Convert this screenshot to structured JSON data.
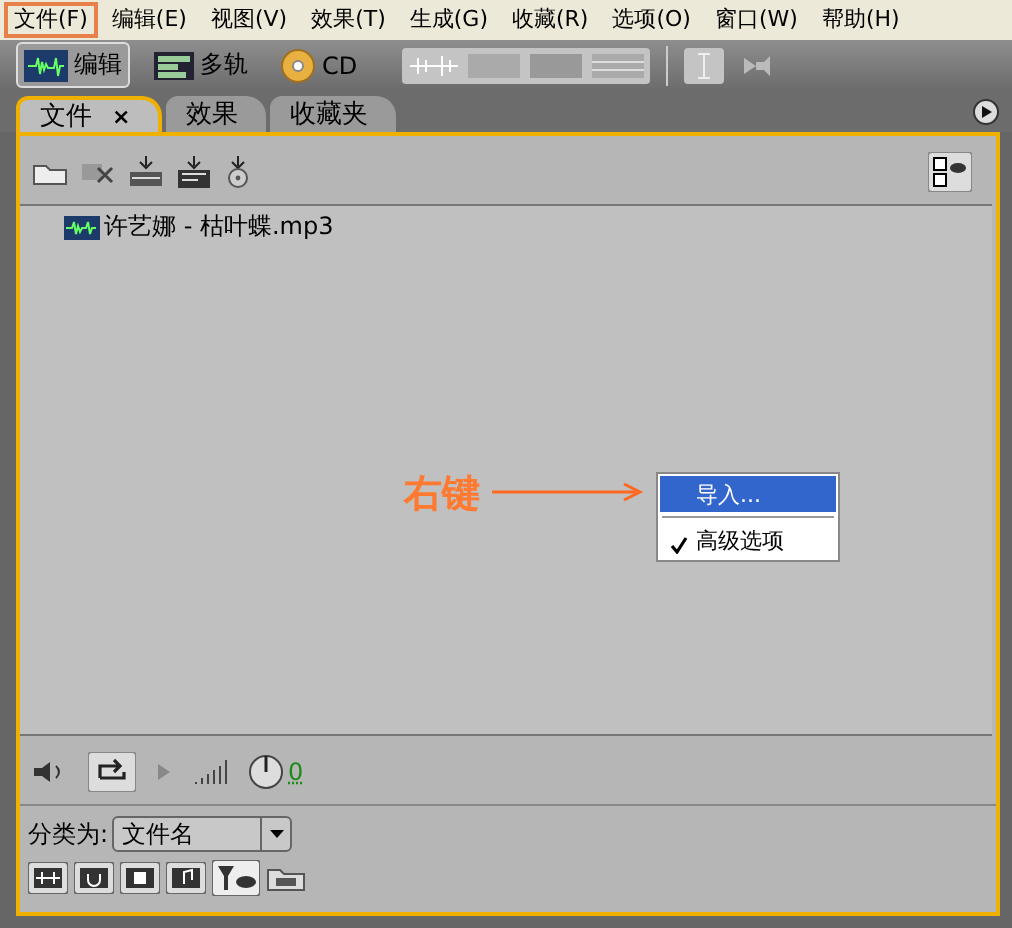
{
  "menu": [
    {
      "label": "文件(F)",
      "selected": true
    },
    {
      "label": "编辑(E)",
      "selected": false
    },
    {
      "label": "视图(V)",
      "selected": false
    },
    {
      "label": "效果(T)",
      "selected": false
    },
    {
      "label": "生成(G)",
      "selected": false
    },
    {
      "label": "收藏(R)",
      "selected": false
    },
    {
      "label": "选项(O)",
      "selected": false
    },
    {
      "label": "窗口(W)",
      "selected": false
    },
    {
      "label": "帮助(H)",
      "selected": false
    }
  ],
  "workspaces": [
    {
      "label": "编辑",
      "selected": true,
      "kind": "wave"
    },
    {
      "label": "多轨",
      "selected": false,
      "kind": "multitrack"
    },
    {
      "label": "CD",
      "selected": false,
      "kind": "cd"
    }
  ],
  "tabs": [
    {
      "label": "文件",
      "selected": true,
      "close": "×"
    },
    {
      "label": "效果",
      "selected": false
    },
    {
      "label": "收藏夹",
      "selected": false
    }
  ],
  "files": [
    {
      "name": "许艺娜 - 枯叶蝶.mp3"
    }
  ],
  "annotation": {
    "text": "右键"
  },
  "context_menu": [
    {
      "label": "导入...",
      "selected": true,
      "checked": false,
      "separator_before": false
    },
    {
      "label": "高级选项",
      "selected": false,
      "checked": true,
      "separator_before": true
    }
  ],
  "volume": {
    "reading": "0"
  },
  "sort": {
    "label": "分类为:",
    "value": "文件名"
  }
}
